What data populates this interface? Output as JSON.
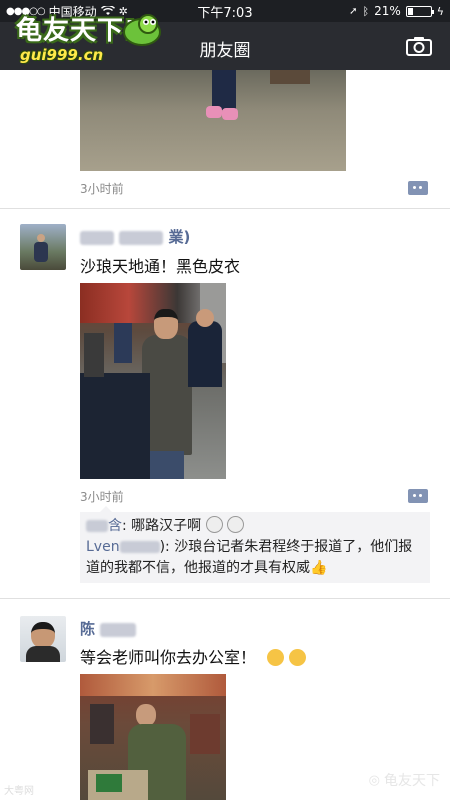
{
  "status_bar": {
    "carrier": "中国移动",
    "time": "下午7:03",
    "battery": "21%",
    "battery_level": 0.21
  },
  "nav": {
    "title": "朋友圈"
  },
  "logo": {
    "text": "龟友天下!",
    "url": "gui999.cn"
  },
  "posts": [
    {
      "time": "3小时前"
    },
    {
      "author_visible": "業)",
      "text": "沙琅天地通！黑色皮衣",
      "time": "3小时前",
      "comments": [
        {
          "name_visible": "含",
          "text": ": 哪路汉子啊"
        },
        {
          "name_visible": "Lven",
          "text": "): 沙琅台记者朱君程终于报道了，他们报道的我都不信，他报道的才具有权威"
        }
      ]
    },
    {
      "author_visible": "陈",
      "text": "等会老师叫你去办公室！"
    }
  ],
  "watermark": {
    "left": "大粤网",
    "right": "龟友天下"
  },
  "colors": {
    "nickname": "#576b95",
    "navbar": "#2a2c31"
  }
}
